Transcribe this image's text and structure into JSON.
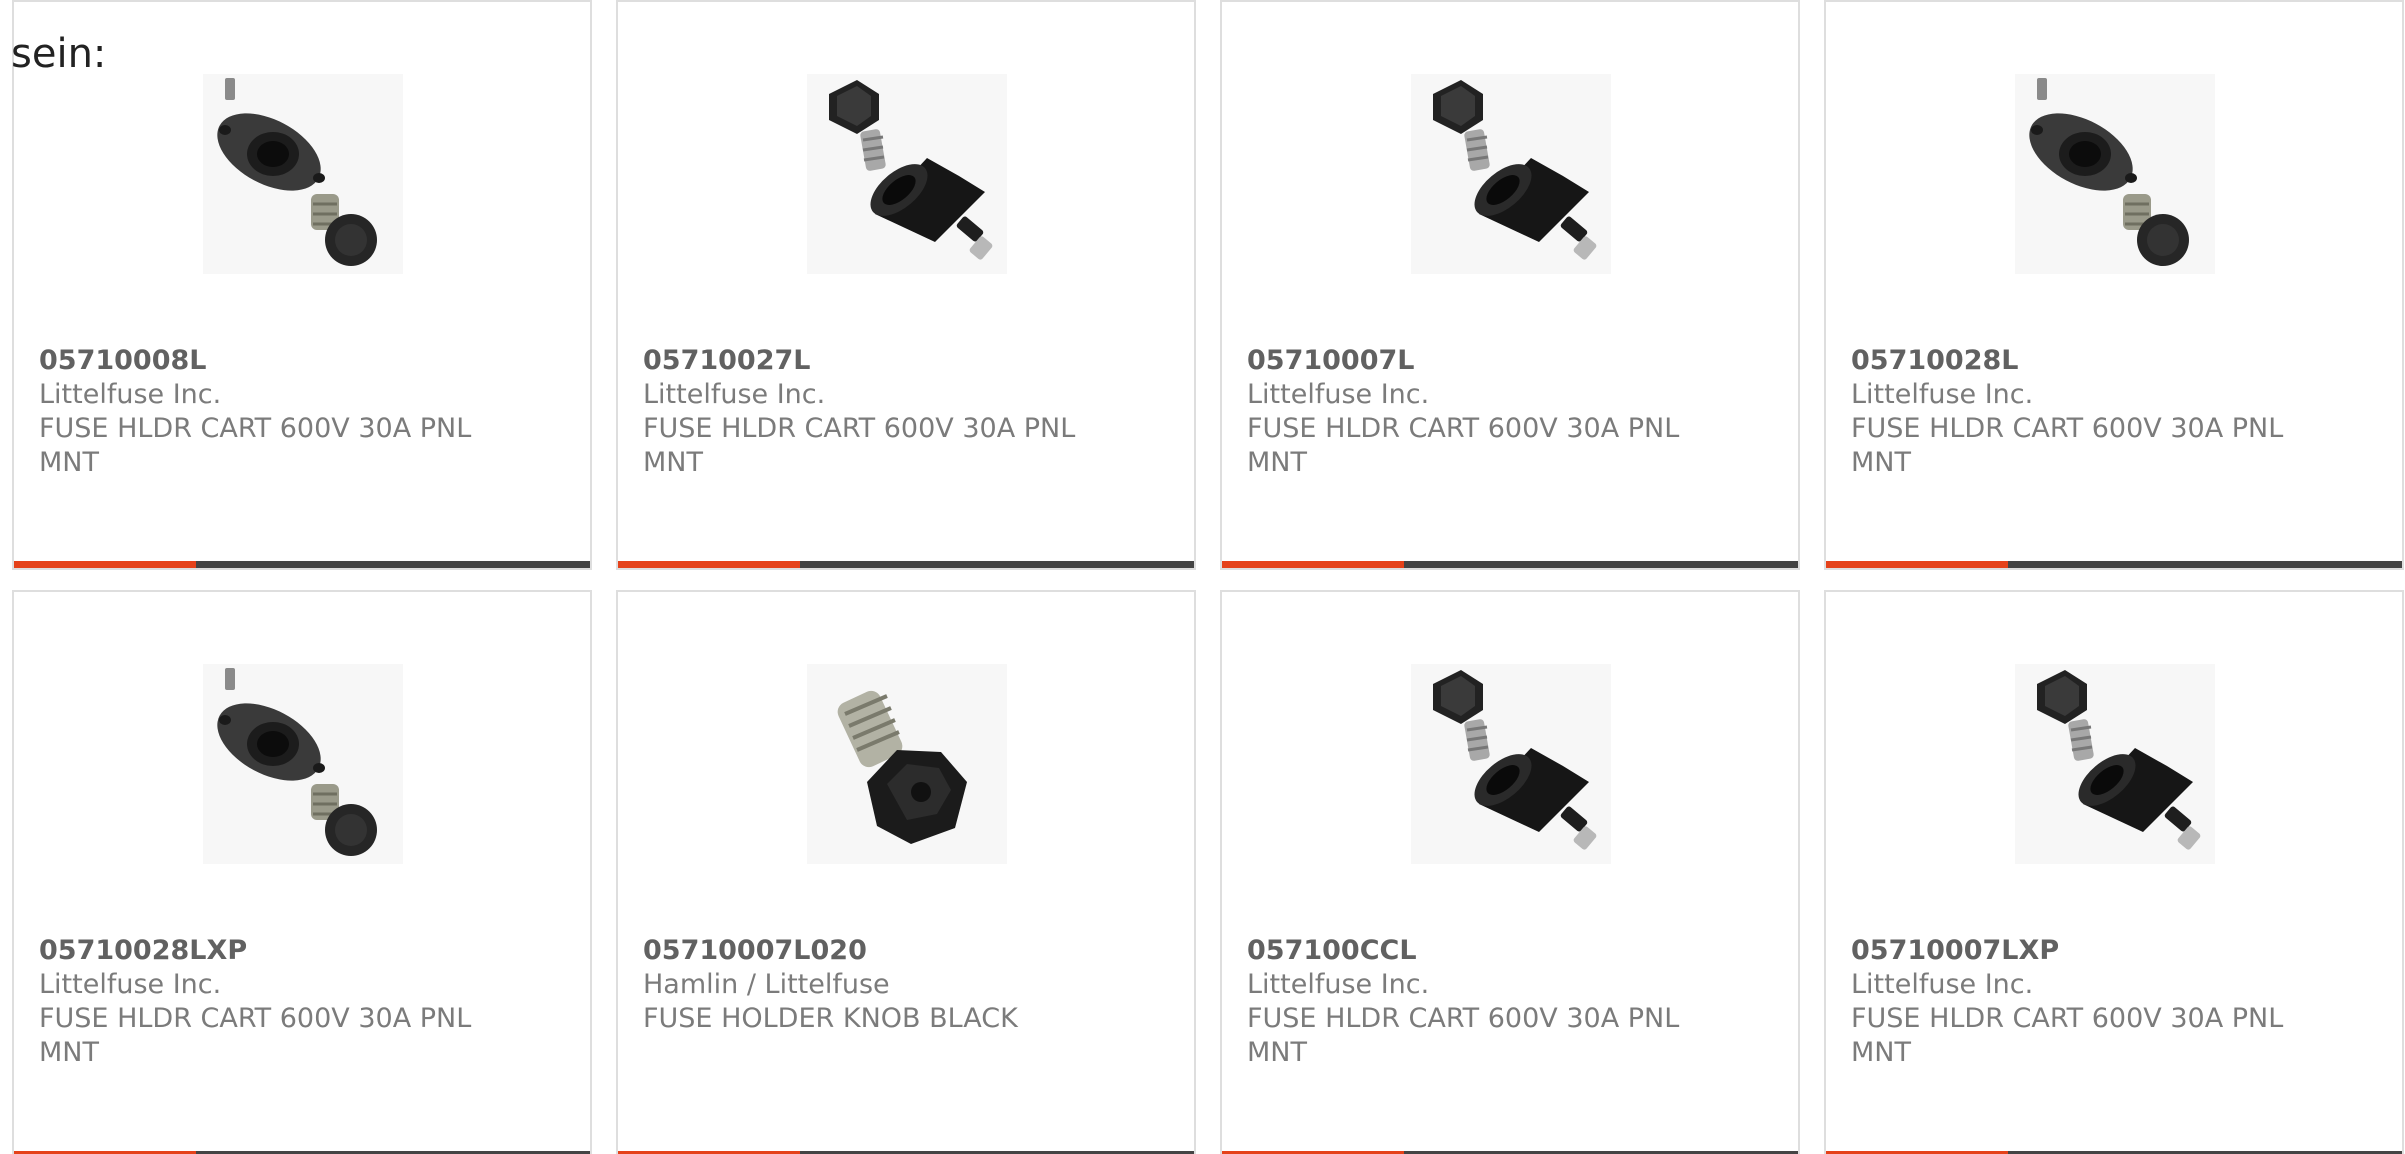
{
  "intro_text": "sein:",
  "colors": {
    "accent": "#e5421a",
    "bar_dark": "#444444",
    "card_border": "#dedede",
    "part_number": "#616161",
    "text": "#7b7b7b"
  },
  "products": [
    {
      "part_number": "05710008L",
      "manufacturer": "Littelfuse Inc.",
      "description": "FUSE HLDR CART 600V 30A PNL MNT",
      "image": "fuse-holder-flange-icon"
    },
    {
      "part_number": "05710027L",
      "manufacturer": "Littelfuse Inc.",
      "description": "FUSE HLDR CART 600V 30A PNL MNT",
      "image": "fuse-holder-diagonal-icon"
    },
    {
      "part_number": "05710007L",
      "manufacturer": "Littelfuse Inc.",
      "description": "FUSE HLDR CART 600V 30A PNL MNT",
      "image": "fuse-holder-diagonal-icon"
    },
    {
      "part_number": "05710028L",
      "manufacturer": "Littelfuse Inc.",
      "description": "FUSE HLDR CART 600V 30A PNL MNT",
      "image": "fuse-holder-flange-icon"
    },
    {
      "part_number": "05710028LXP",
      "manufacturer": "Littelfuse Inc.",
      "description": "FUSE HLDR CART 600V 30A PNL MNT",
      "image": "fuse-holder-flange-icon"
    },
    {
      "part_number": "05710007L020",
      "manufacturer": "Hamlin / Littelfuse",
      "description": "FUSE HOLDER KNOB BLACK",
      "image": "fuse-knob-icon"
    },
    {
      "part_number": "057100CCL",
      "manufacturer": "Littelfuse Inc.",
      "description": "FUSE HLDR CART 600V 30A PNL MNT",
      "image": "fuse-holder-diagonal-icon"
    },
    {
      "part_number": "05710007LXP",
      "manufacturer": "Littelfuse Inc.",
      "description": "FUSE HLDR CART 600V 30A PNL MNT",
      "image": "fuse-holder-diagonal-icon"
    }
  ]
}
